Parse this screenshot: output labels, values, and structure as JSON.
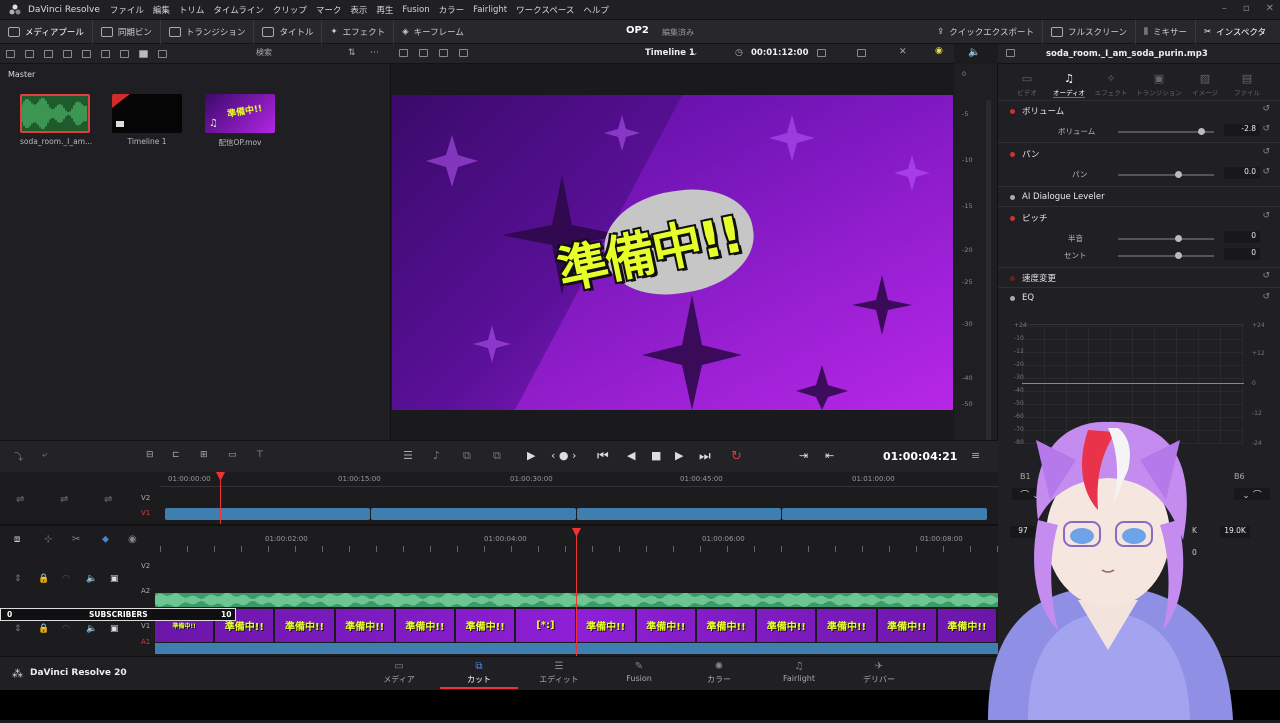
{
  "titlebar": {
    "app": "DaVinci Resolve",
    "menus": [
      "ファイル",
      "編集",
      "トリム",
      "タイムライン",
      "クリップ",
      "マーク",
      "表示",
      "再生",
      "Fusion",
      "カラー",
      "Fairlight",
      "ワークスペース",
      "ヘルプ"
    ]
  },
  "toolbar": {
    "left": [
      "メディアプール",
      "同期ビン",
      "トランジション",
      "タイトル",
      "エフェクト",
      "キーフレーム"
    ],
    "project": "OP2",
    "project_status": "編集済み",
    "right": [
      "クイックエクスポート",
      "フルスクリーン",
      "ミキサー",
      "インスペクタ"
    ]
  },
  "mediapool": {
    "search_placeholder": "検索",
    "bin": "Master",
    "clips": [
      {
        "name": "soda_room._I_am..."
      },
      {
        "name": "Timeline 1"
      },
      {
        "name": "配信OP.mov"
      }
    ]
  },
  "viewer": {
    "timeline_name": "Timeline 1",
    "timecode_duration": "00:01:12:00",
    "timecode_current": "01:00:04:21",
    "overlay_text": "準備中!!"
  },
  "meter": {
    "labels": [
      "0",
      "-5",
      "-10",
      "-15",
      "-20",
      "-25",
      "-30",
      "-40",
      "-50"
    ]
  },
  "inspector": {
    "filename": "soda_room._I_am_soda_purin.mp3",
    "tabs": [
      "ビデオ",
      "オーディオ",
      "エフェクト",
      "トランジション",
      "イメージ",
      "ファイル"
    ],
    "volume_section": "ボリューム",
    "volume_label": "ボリューム",
    "volume_value": "-2.8",
    "pan_section": "パン",
    "pan_label": "パン",
    "pan_value": "0.0",
    "dialogue": "AI Dialogue Leveler",
    "pitch_section": "ピッチ",
    "semitone_label": "半音",
    "semitone_value": "0",
    "cent_label": "セント",
    "cent_value": "0",
    "speed": "速度変更",
    "eq": "EQ",
    "eq_left_scale": [
      "+24",
      "-10",
      "-12",
      "-20",
      "-30",
      "-40",
      "-50",
      "-60",
      "-70",
      "-80"
    ],
    "eq_right_scale": [
      "+24",
      "+12",
      "0",
      "-12",
      "-24"
    ],
    "eq_bands": [
      "B1",
      "B6"
    ],
    "eq_band_values": [
      "97",
      "19.0K"
    ],
    "eq_mid_values": [
      "K",
      "0"
    ]
  },
  "timeline": {
    "upper_ruler": [
      "01:00:00:00",
      "01:00:15:00",
      "01:00:30:00",
      "01:00:45:00",
      "01:01:00:00"
    ],
    "lower_ruler": [
      "01:00:02:00",
      "01:00:04:00",
      "01:00:06:00",
      "01:00:08:00"
    ],
    "track_labels": [
      "V2",
      "V1",
      "V2",
      "A2",
      "V1",
      "A1"
    ],
    "subs": {
      "left": "0",
      "label": "SUBSCRIBERS",
      "right": "10"
    },
    "frame_text": "準備中!!",
    "frame_text_current": "[*:]"
  },
  "pages": {
    "brand": "DaVinci Resolve 20",
    "items": [
      "メディア",
      "カット",
      "エディット",
      "Fusion",
      "カラー",
      "Fairlight",
      "デリバー"
    ]
  }
}
